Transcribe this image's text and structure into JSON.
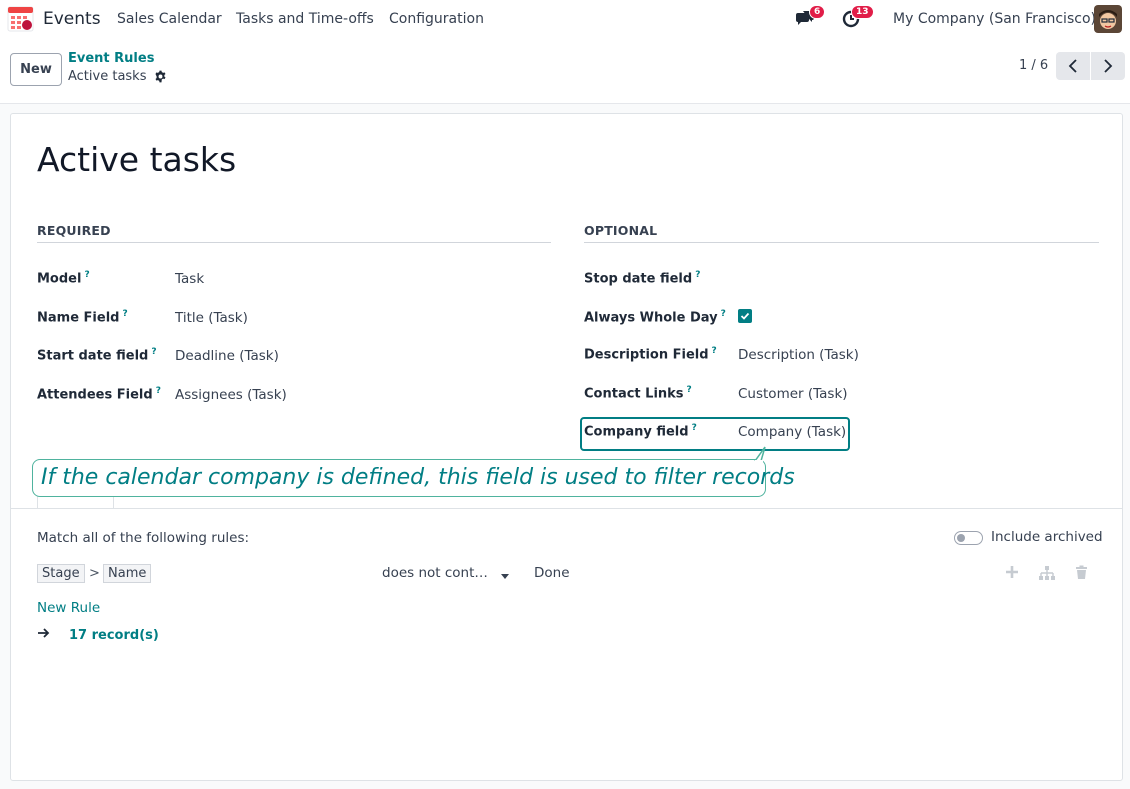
{
  "navbar": {
    "app_name": "Events",
    "menus": [
      "Sales Calendar",
      "Tasks and Time-offs",
      "Configuration"
    ],
    "messages_badge": "6",
    "activities_badge": "13",
    "company": "My Company (San Francisco)"
  },
  "control_panel": {
    "new_label": "New",
    "breadcrumb_parent": "Event Rules",
    "breadcrumb_current": "Active tasks",
    "pager": "1 / 6"
  },
  "form": {
    "title": "Active tasks",
    "required": {
      "heading": "REQUIRED",
      "fields": [
        {
          "label": "Model",
          "value": "Task"
        },
        {
          "label": "Name Field",
          "value": "Title (Task)"
        },
        {
          "label": "Start date field",
          "value": "Deadline (Task)"
        },
        {
          "label": "Attendees Field",
          "value": "Assignees (Task)"
        }
      ]
    },
    "optional": {
      "heading": "OPTIONAL",
      "fields": [
        {
          "label": "Stop date field",
          "value": ""
        },
        {
          "label": "Always Whole Day",
          "value": true
        },
        {
          "label": "Description Field",
          "value": "Description (Task)"
        },
        {
          "label": "Contact Links",
          "value": "Customer (Task)"
        },
        {
          "label": "Company field",
          "value": "Company (Task)"
        }
      ]
    },
    "help_mark": "?",
    "tooltip": "If the calendar company is defined, this field is used to filter records"
  },
  "domain": {
    "match_text": "Match all of the following rules:",
    "include_archived": "Include archived",
    "rule": {
      "path": [
        "Stage",
        "Name"
      ],
      "path_separator": ">",
      "operator": "does not cont…",
      "value": "Done"
    },
    "new_rule": "New Rule",
    "records": "17 record(s)"
  },
  "colors": {
    "accent": "#017e84",
    "badge": "#e11d48"
  }
}
